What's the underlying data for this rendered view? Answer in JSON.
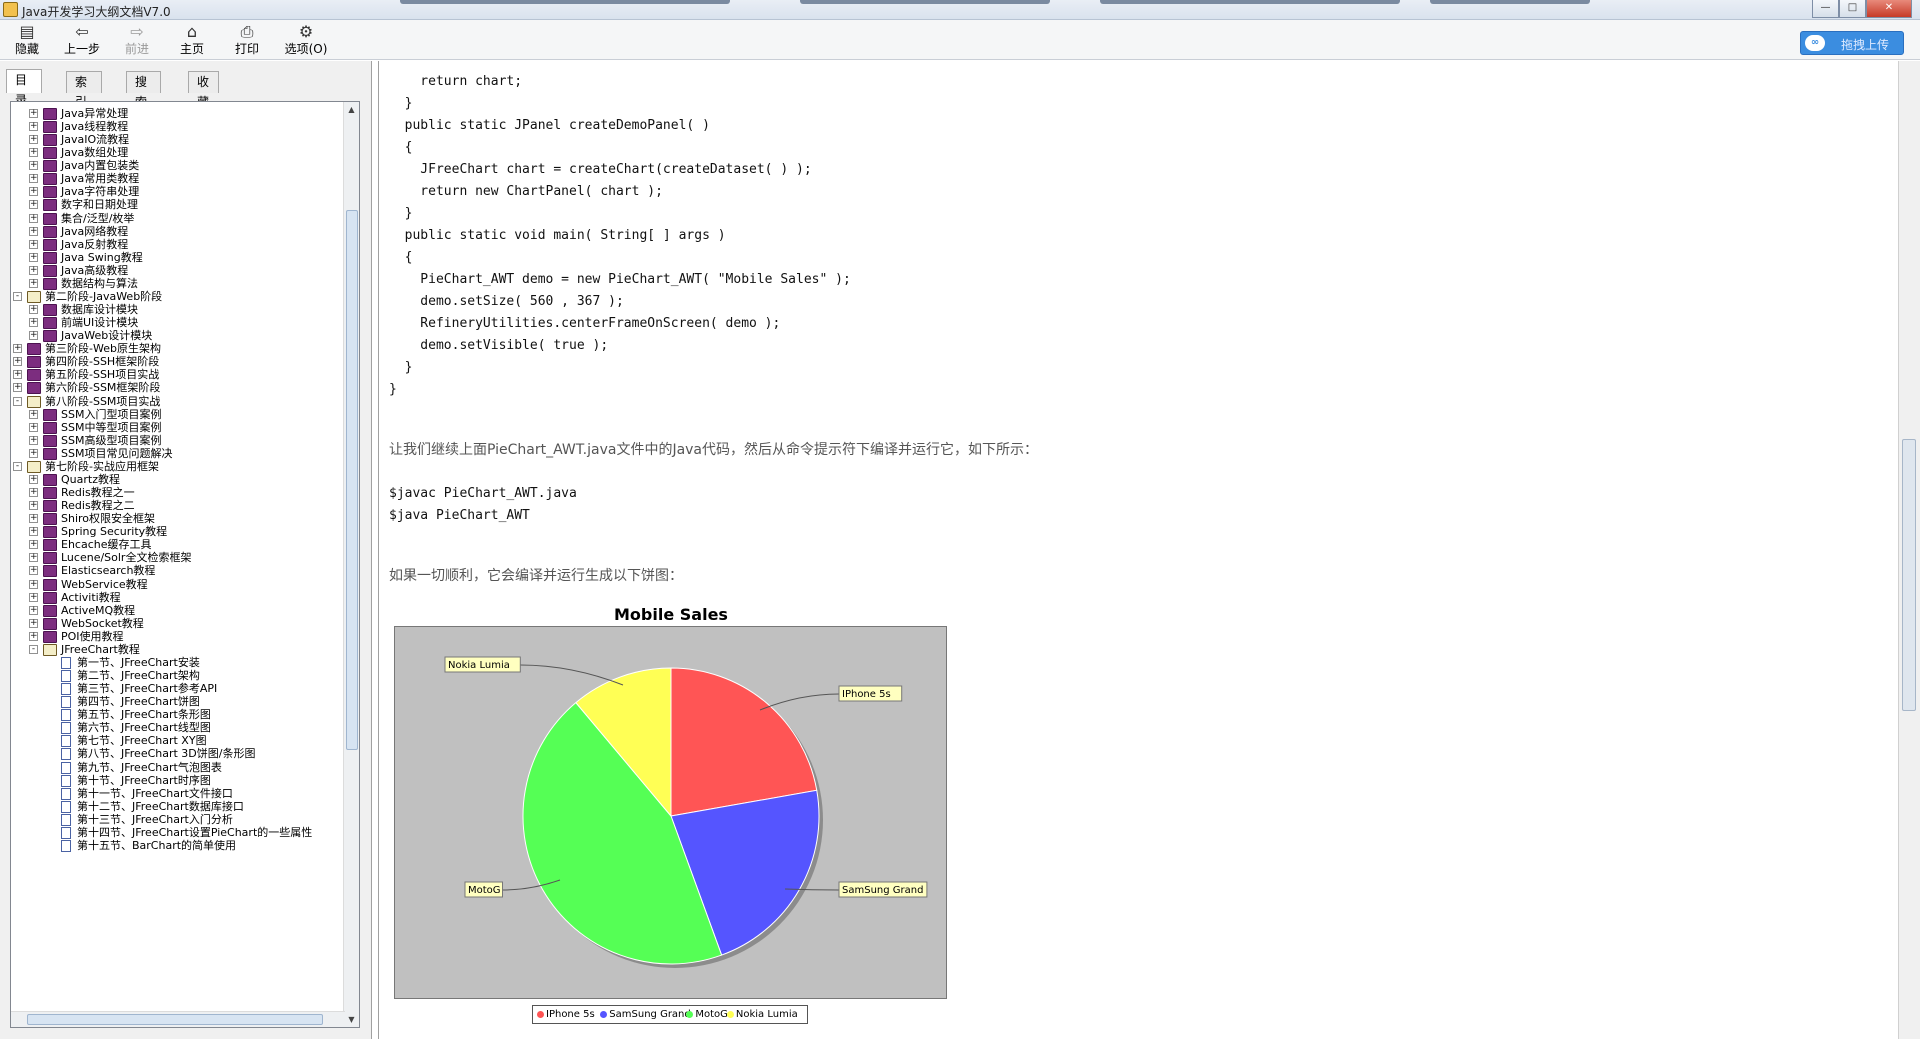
{
  "window": {
    "title": "Java开发学习大纲文档V7.0"
  },
  "toolbar": {
    "hide": "隐藏",
    "back": "上一步",
    "forward": "前进",
    "home": "主页",
    "print": "打印",
    "options": "选项(O)",
    "upload": "拖拽上传"
  },
  "tabs": [
    "目录(C)",
    "索引(N)",
    "搜索(S)",
    "收藏夹(I)"
  ],
  "tree": [
    {
      "label": "Java异常处理",
      "level": 1,
      "kind": "book",
      "exp": "+"
    },
    {
      "label": "Java线程教程",
      "level": 1,
      "kind": "book",
      "exp": "+"
    },
    {
      "label": "JavaIO流教程",
      "level": 1,
      "kind": "book",
      "exp": "+"
    },
    {
      "label": "Java数组处理",
      "level": 1,
      "kind": "book",
      "exp": "+"
    },
    {
      "label": "Java内置包装类",
      "level": 1,
      "kind": "book",
      "exp": "+"
    },
    {
      "label": "Java常用类教程",
      "level": 1,
      "kind": "book",
      "exp": "+"
    },
    {
      "label": "Java字符串处理",
      "level": 1,
      "kind": "book",
      "exp": "+"
    },
    {
      "label": "数字和日期处理",
      "level": 1,
      "kind": "book",
      "exp": "+"
    },
    {
      "label": "集合/泛型/枚举",
      "level": 1,
      "kind": "book",
      "exp": "+"
    },
    {
      "label": "Java网络教程",
      "level": 1,
      "kind": "book",
      "exp": "+"
    },
    {
      "label": "Java反射教程",
      "level": 1,
      "kind": "book",
      "exp": "+"
    },
    {
      "label": "Java Swing教程",
      "level": 1,
      "kind": "book",
      "exp": "+"
    },
    {
      "label": "Java高级教程",
      "level": 1,
      "kind": "book",
      "exp": "+"
    },
    {
      "label": "数据结构与算法",
      "level": 1,
      "kind": "book",
      "exp": "+"
    },
    {
      "label": "第二阶段-JavaWeb阶段",
      "level": 0,
      "kind": "open",
      "exp": "-"
    },
    {
      "label": "数据库设计模块",
      "level": 1,
      "kind": "book",
      "exp": "+"
    },
    {
      "label": "前端UI设计模块",
      "level": 1,
      "kind": "book",
      "exp": "+"
    },
    {
      "label": "JavaWeb设计模块",
      "level": 1,
      "kind": "book",
      "exp": "+"
    },
    {
      "label": "第三阶段-Web原生架构",
      "level": 0,
      "kind": "book",
      "exp": "+"
    },
    {
      "label": "第四阶段-SSH框架阶段",
      "level": 0,
      "kind": "book",
      "exp": "+"
    },
    {
      "label": "第五阶段-SSH项目实战",
      "level": 0,
      "kind": "book",
      "exp": "+"
    },
    {
      "label": "第六阶段-SSM框架阶段",
      "level": 0,
      "kind": "book",
      "exp": "+"
    },
    {
      "label": "第八阶段-SSM项目实战",
      "level": 0,
      "kind": "open",
      "exp": "-"
    },
    {
      "label": "SSM入门型项目案例",
      "level": 1,
      "kind": "book",
      "exp": "+"
    },
    {
      "label": "SSM中等型项目案例",
      "level": 1,
      "kind": "book",
      "exp": "+"
    },
    {
      "label": "SSM高级型项目案例",
      "level": 1,
      "kind": "book",
      "exp": "+"
    },
    {
      "label": "SSM项目常见问题解决",
      "level": 1,
      "kind": "book",
      "exp": "+"
    },
    {
      "label": "第七阶段-实战应用框架",
      "level": 0,
      "kind": "open",
      "exp": "-"
    },
    {
      "label": "Quartz教程",
      "level": 1,
      "kind": "book",
      "exp": "+"
    },
    {
      "label": "Redis教程之一",
      "level": 1,
      "kind": "book",
      "exp": "+"
    },
    {
      "label": "Redis教程之二",
      "level": 1,
      "kind": "book",
      "exp": "+"
    },
    {
      "label": "Shiro权限安全框架",
      "level": 1,
      "kind": "book",
      "exp": "+"
    },
    {
      "label": "Spring Security教程",
      "level": 1,
      "kind": "book",
      "exp": "+"
    },
    {
      "label": "Ehcache缓存工具",
      "level": 1,
      "kind": "book",
      "exp": "+"
    },
    {
      "label": "Lucene/Solr全文检索框架",
      "level": 1,
      "kind": "book",
      "exp": "+"
    },
    {
      "label": "Elasticsearch教程",
      "level": 1,
      "kind": "book",
      "exp": "+"
    },
    {
      "label": "WebService教程",
      "level": 1,
      "kind": "book",
      "exp": "+"
    },
    {
      "label": "Activiti教程",
      "level": 1,
      "kind": "book",
      "exp": "+"
    },
    {
      "label": "ActiveMQ教程",
      "level": 1,
      "kind": "book",
      "exp": "+"
    },
    {
      "label": "WebSocket教程",
      "level": 1,
      "kind": "book",
      "exp": "+"
    },
    {
      "label": "POI使用教程",
      "level": 1,
      "kind": "book",
      "exp": "+"
    },
    {
      "label": "JFreeChart教程",
      "level": 1,
      "kind": "open",
      "exp": "-"
    },
    {
      "label": "第一节、JFreeChart安装",
      "level": 2,
      "kind": "doc"
    },
    {
      "label": "第二节、JFreeChart架构",
      "level": 2,
      "kind": "doc"
    },
    {
      "label": "第三节、JFreeChart参考API",
      "level": 2,
      "kind": "doc"
    },
    {
      "label": "第四节、JFreeChart饼图",
      "level": 2,
      "kind": "doc"
    },
    {
      "label": "第五节、JFreeChart条形图",
      "level": 2,
      "kind": "doc"
    },
    {
      "label": "第六节、JFreeChart线型图",
      "level": 2,
      "kind": "doc"
    },
    {
      "label": "第七节、JFreeChart XY图",
      "level": 2,
      "kind": "doc"
    },
    {
      "label": "第八节、JFreeChart 3D饼图/条形图",
      "level": 2,
      "kind": "doc"
    },
    {
      "label": "第九节、JFreeChart气泡图表",
      "level": 2,
      "kind": "doc"
    },
    {
      "label": "第十节、JFreeChart时序图",
      "level": 2,
      "kind": "doc"
    },
    {
      "label": "第十一节、JFreeChart文件接口",
      "level": 2,
      "kind": "doc"
    },
    {
      "label": "第十二节、JFreeChart数据库接口",
      "level": 2,
      "kind": "doc"
    },
    {
      "label": "第十三节、JFreeChart入门分析",
      "level": 2,
      "kind": "doc"
    },
    {
      "label": "第十四节、JFreeChart设置PieChart的一些属性",
      "level": 2,
      "kind": "doc"
    },
    {
      "label": "第十五节、BarChart的简单使用",
      "level": 2,
      "kind": "doc"
    }
  ],
  "code_top": [
    "    return chart;",
    "  }",
    "  public static JPanel createDemoPanel( )",
    "  {",
    "    JFreeChart chart = createChart(createDataset( ) );",
    "    return new ChartPanel( chart );",
    "  }",
    "  public static void main( String[ ] args )",
    "  {",
    "    PieChart_AWT demo = new PieChart_AWT( \"Mobile Sales\" );",
    "    demo.setSize( 560 , 367 );",
    "    RefineryUtilities.centerFrameOnScreen( demo );",
    "    demo.setVisible( true );",
    "  }",
    "}"
  ],
  "para1": "让我们继续上面PieChart_AWT.java文件中的Java代码，然后从命令提示符下编译并运行它，如下所示：",
  "code_cmd": [
    "$javac PieChart_AWT.java",
    "$java PieChart_AWT"
  ],
  "para2": "如果一切顺利，它会编译并运行生成以下饼图：",
  "chart_data": {
    "type": "pie",
    "title": "Mobile Sales",
    "categories": [
      "IPhone 5s",
      "SamSung Grand",
      "MotoG",
      "Nokia Lumia"
    ],
    "values": [
      20,
      20,
      40,
      10
    ],
    "colors": [
      "#ff5555",
      "#5555ff",
      "#55ff55",
      "#ffff55"
    ],
    "legend": "bottom"
  }
}
